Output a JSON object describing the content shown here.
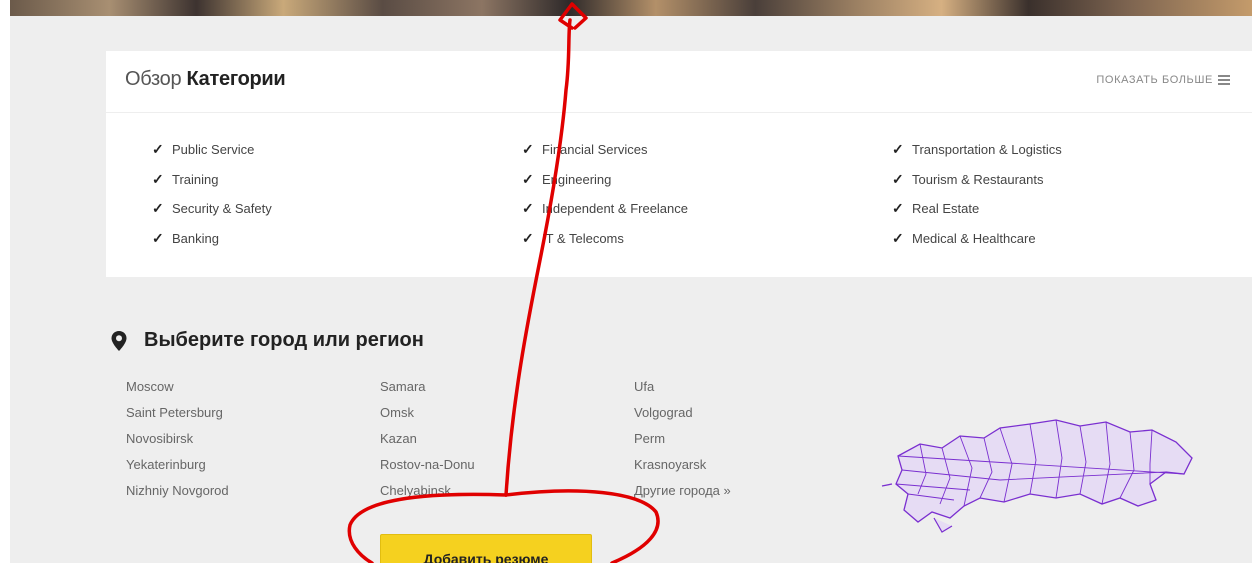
{
  "categories": {
    "title_prefix": "Обзор",
    "title_main": "Категории",
    "show_more": "ПОКАЗАТЬ БОЛЬШЕ",
    "items": [
      "Public Service",
      "Training",
      "Security & Safety",
      "Banking",
      "Financial Services",
      "Engineering",
      "Independent & Freelance",
      "IT & Telecoms",
      "Transportation & Logistics",
      "Tourism & Restaurants",
      "Real Estate",
      "Medical & Healthcare"
    ],
    "check_glyph": "✓"
  },
  "cities": {
    "heading": "Выберите город или регион",
    "items": [
      "Moscow",
      "Saint Petersburg",
      "Novosibirsk",
      "Yekaterinburg",
      "Nizhniy Novgorod",
      "Samara",
      "Omsk",
      "Kazan",
      "Rostov-na-Donu",
      "Chelyabinsk",
      "Ufa",
      "Volgograd",
      "Perm",
      "Krasnoyarsk",
      "Другие города »"
    ]
  },
  "actions": {
    "add_resume": "Добавить резюме"
  },
  "colors": {
    "accent_button": "#f5d11f",
    "map_fill": "#e6dcf4",
    "map_stroke": "#7a2fd0",
    "annotation": "#e00000"
  },
  "icons": {
    "pin": "map-pin-icon",
    "menu": "menu-icon",
    "check": "check-icon"
  }
}
